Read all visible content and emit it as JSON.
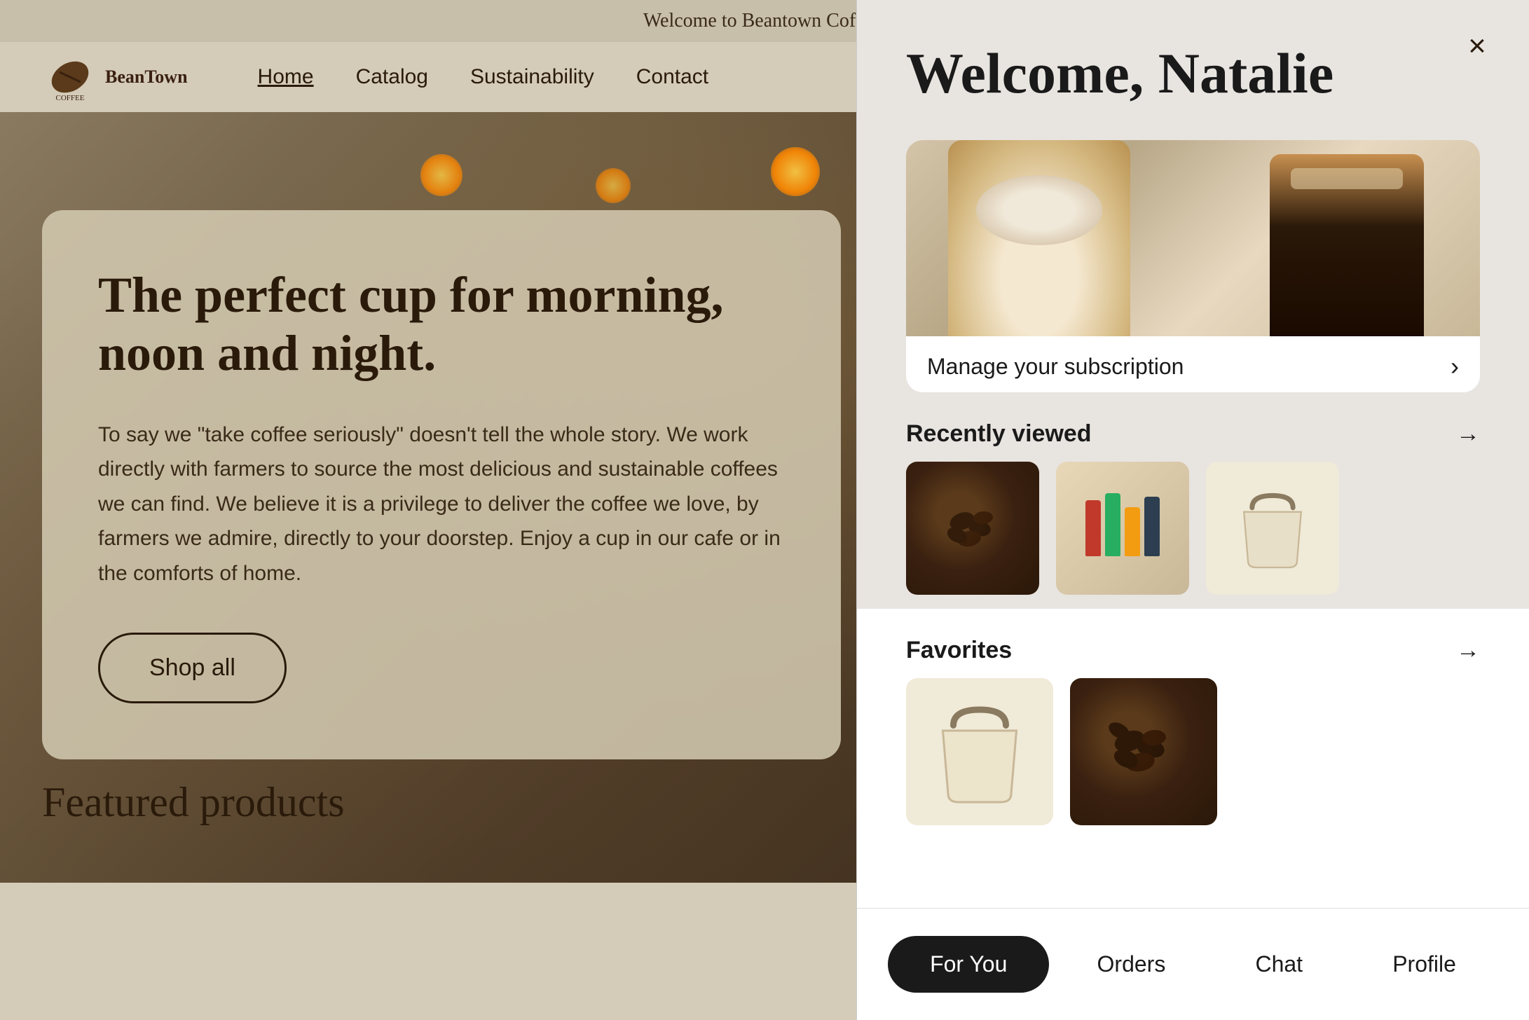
{
  "website": {
    "banner_text": "Welcome to Beantown Coffee!",
    "logo_text": "BeanTown",
    "nav_links": [
      {
        "label": "Home",
        "active": true
      },
      {
        "label": "Catalog",
        "active": false
      },
      {
        "label": "Sustainability",
        "active": false
      },
      {
        "label": "Contact",
        "active": false
      }
    ],
    "hero": {
      "headline": "The perfect cup for morning, noon and night.",
      "body": "To say we \"take coffee seriously\" doesn't tell the whole story. We work directly with farmers to source the most delicious and sustainable coffees we can find. We believe it is a privilege to deliver the coffee we love, by farmers we admire, directly to your doorstep. Enjoy a cup in our cafe or in the comforts of home.",
      "cta_label": "Shop all"
    },
    "featured_label": "Featured products"
  },
  "panel": {
    "welcome_text": "Welcome, Natalie",
    "close_label": "×",
    "subscription": {
      "label": "Manage your subscription",
      "chevron": "›"
    },
    "recently_viewed": {
      "title": "Recently viewed",
      "arrow": "→"
    },
    "favorites": {
      "title": "Favorites",
      "arrow": "→"
    },
    "bottom_nav": [
      {
        "label": "For You",
        "active": true
      },
      {
        "label": "Orders",
        "active": false
      },
      {
        "label": "Chat",
        "active": false
      },
      {
        "label": "Profile",
        "active": false
      }
    ]
  }
}
